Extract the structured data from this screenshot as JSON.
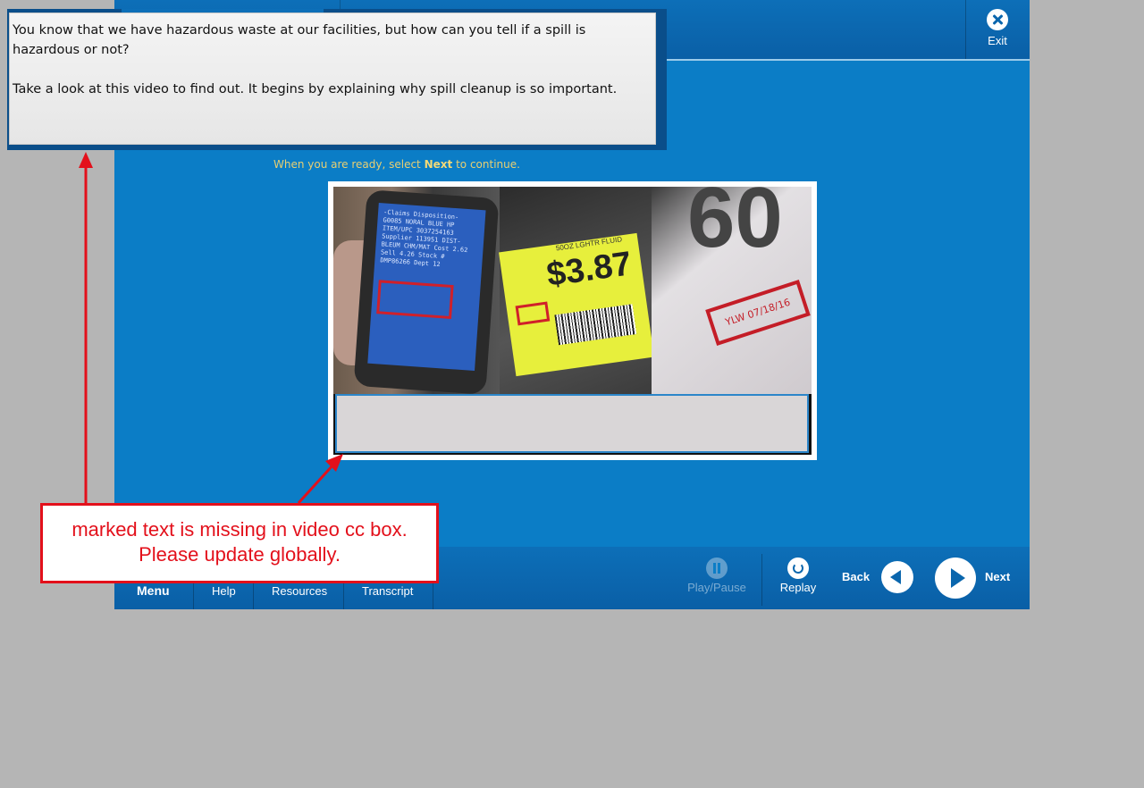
{
  "topbar": {
    "exit_label": "Exit"
  },
  "caption_pane": {
    "paragraph1": "You know that we have hazardous waste at our facilities, but how can you tell if a spill is hazardous or not?",
    "paragraph2": "Take a look at this video to find out.  It begins by explaining why spill cleanup is so important."
  },
  "instruction": {
    "before": "When you are ready, select ",
    "bold": "Next",
    "after": " to continue."
  },
  "video": {
    "price_text": "$3.87",
    "tag_small_text": "50OZ LGHTR FLUID",
    "shelf_label_text": "YLW 07/18/16",
    "shelf_number_text": "60",
    "phone_screen_text": "-Claims Disposition- G0085 NORAL BLUE HP ITEM/UPC 3037254163 Supplier 113951 DIST-BLEUM CHM/MAT Cost 2.62 Sell 4.26 Stock # DMP86266 Dept 12"
  },
  "bottombar": {
    "menu_label": "Menu",
    "help_label": "Help",
    "resources_label": "Resources",
    "transcript_label": "Transcript",
    "play_pause_label": "Play/Pause",
    "replay_label": "Replay",
    "back_label": "Back",
    "next_label": "Next"
  },
  "annotation": {
    "line1": "marked text is missing in video cc box.",
    "line2": "Please update globally."
  },
  "colors": {
    "stage_blue": "#0b7dc6",
    "background_gray": "#b5b5b5",
    "annotation_red": "#e3101b",
    "instruction_gold": "#e8cf72"
  }
}
